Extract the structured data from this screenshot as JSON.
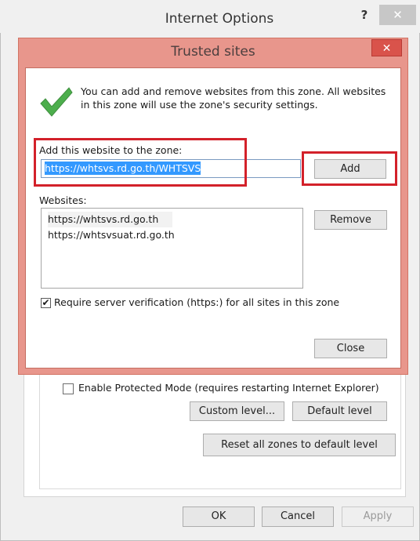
{
  "parent_window": {
    "title": "Internet Options",
    "help_glyph": "?",
    "close_glyph": "✕",
    "enable_protected_mode_label": "Enable Protected Mode (requires restarting Internet Explorer)",
    "enable_protected_mode_checked": false,
    "custom_level_label": "Custom level...",
    "default_level_label": "Default level",
    "reset_all_label": "Reset all zones to default level",
    "ok_label": "OK",
    "cancel_label": "Cancel",
    "apply_label": "Apply"
  },
  "dialog": {
    "title": "Trusted sites",
    "close_glyph": "✕",
    "info_text": "You can add and remove websites from this zone. All websites in this zone will use the zone's security settings.",
    "add_label": "Add this website to the zone:",
    "url_value": "https://whtsvs.rd.go.th/WHTSVS",
    "add_button": "Add",
    "websites_label": "Websites:",
    "websites": [
      "https://whtsvs.rd.go.th",
      "https://whtsvsuat.rd.go.th"
    ],
    "remove_button": "Remove",
    "require_verification_label": "Require server verification (https:) for all sites in this zone",
    "require_verification_checked": true,
    "close_button": "Close"
  },
  "colors": {
    "dialog_frame": "#e8968c",
    "highlight_box": "#d3212a",
    "selection": "#3399ff",
    "check_icon": "#4cae4c"
  },
  "icons": {
    "info": "checkmark-icon",
    "checkbox_mark": "check-mark-icon"
  }
}
